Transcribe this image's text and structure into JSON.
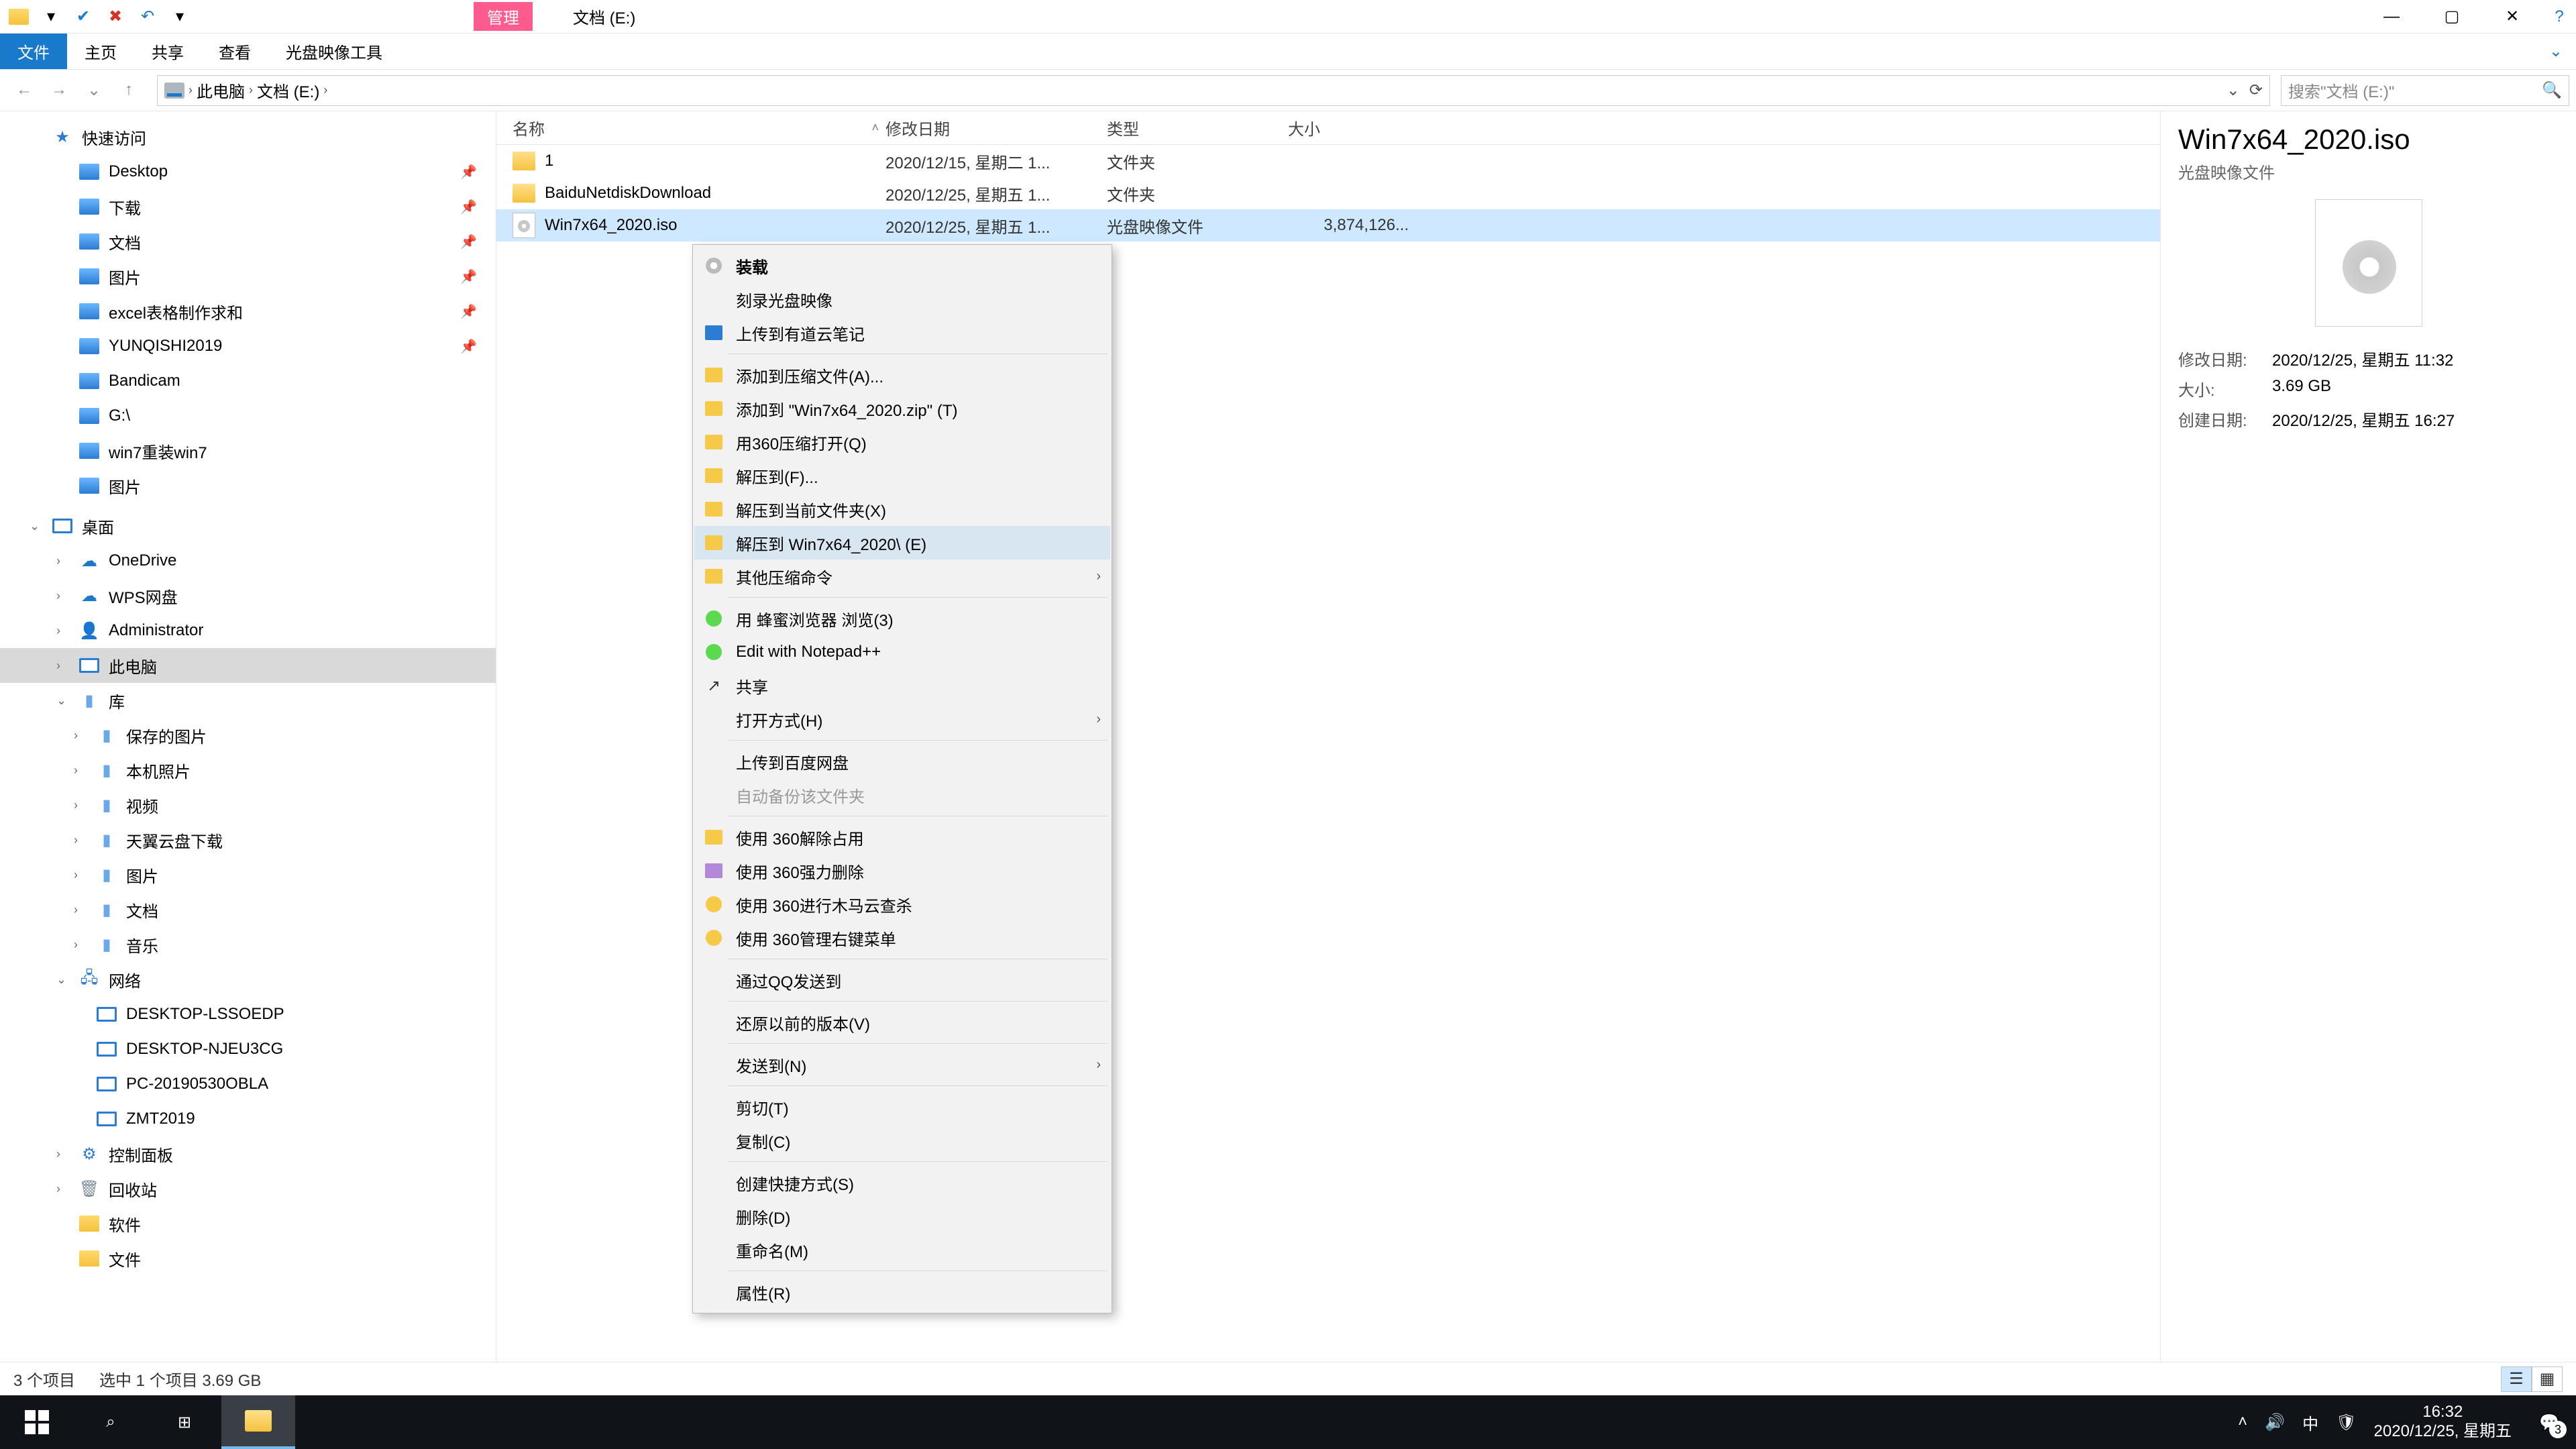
{
  "window": {
    "context_tab": "管理",
    "title": "文档 (E:)",
    "tabs": {
      "file": "文件",
      "home": "主页",
      "share": "共享",
      "view": "查看",
      "image_tool": "光盘映像工具"
    }
  },
  "address": {
    "crumbs": [
      "此电脑",
      "文档 (E:)"
    ],
    "search_placeholder": "搜索\"文档 (E:)\""
  },
  "tree": {
    "quick": "快速访问",
    "quick_items": [
      "Desktop",
      "下载",
      "文档",
      "图片",
      "excel表格制作求和",
      "YUNQISHI2019",
      "Bandicam",
      "G:\\",
      "win7重装win7",
      "图片"
    ],
    "desktop_root": "桌面",
    "desktop_items": [
      "OneDrive",
      "WPS网盘",
      "Administrator",
      "此电脑",
      "库"
    ],
    "lib_items": [
      "保存的图片",
      "本机照片",
      "视频",
      "天翼云盘下载",
      "图片",
      "文档",
      "音乐"
    ],
    "network": "网络",
    "net_items": [
      "DESKTOP-LSSOEDP",
      "DESKTOP-NJEU3CG",
      "PC-20190530OBLA",
      "ZMT2019"
    ],
    "others": [
      "控制面板",
      "回收站",
      "软件",
      "文件"
    ]
  },
  "columns": {
    "name": "名称",
    "date": "修改日期",
    "type": "类型",
    "size": "大小"
  },
  "rows": [
    {
      "name": "1",
      "date": "2020/12/15, 星期二 1...",
      "type": "文件夹",
      "size": ""
    },
    {
      "name": "BaiduNetdiskDownload",
      "date": "2020/12/25, 星期五 1...",
      "type": "文件夹",
      "size": ""
    },
    {
      "name": "Win7x64_2020.iso",
      "date": "2020/12/25, 星期五 1...",
      "type": "光盘映像文件",
      "size": "3,874,126..."
    }
  ],
  "ctx": {
    "items": [
      {
        "label": "装载",
        "icon": "disc",
        "bold": true
      },
      {
        "label": "刻录光盘映像",
        "icon": ""
      },
      {
        "label": "上传到有道云笔记",
        "icon": "sq-b"
      },
      {
        "sep": true
      },
      {
        "label": "添加到压缩文件(A)...",
        "icon": "sq-y"
      },
      {
        "label": "添加到 \"Win7x64_2020.zip\" (T)",
        "icon": "sq-y"
      },
      {
        "label": "用360压缩打开(Q)",
        "icon": "sq-y"
      },
      {
        "label": "解压到(F)...",
        "icon": "sq-y"
      },
      {
        "label": "解压到当前文件夹(X)",
        "icon": "sq-y"
      },
      {
        "label": "解压到 Win7x64_2020\\ (E)",
        "icon": "sq-y",
        "hover": true
      },
      {
        "label": "其他压缩命令",
        "icon": "sq-y",
        "sub": true
      },
      {
        "sep": true
      },
      {
        "label": "用 蜂蜜浏览器 浏览(3)",
        "icon": "circ-g"
      },
      {
        "label": "Edit with Notepad++",
        "icon": "circ-g"
      },
      {
        "label": "共享",
        "icon": "share"
      },
      {
        "label": "打开方式(H)",
        "icon": "",
        "sub": true
      },
      {
        "sep": true
      },
      {
        "label": "上传到百度网盘",
        "icon": ""
      },
      {
        "label": "自动备份该文件夹",
        "icon": "",
        "disabled": true
      },
      {
        "sep": true
      },
      {
        "label": "使用 360解除占用",
        "icon": "sq-y"
      },
      {
        "label": "使用 360强力删除",
        "icon": "sq-p"
      },
      {
        "label": "使用 360进行木马云查杀",
        "icon": "circ-y"
      },
      {
        "label": "使用 360管理右键菜单",
        "icon": "circ-y"
      },
      {
        "sep": true
      },
      {
        "label": "通过QQ发送到",
        "icon": ""
      },
      {
        "sep": true
      },
      {
        "label": "还原以前的版本(V)",
        "icon": ""
      },
      {
        "sep": true
      },
      {
        "label": "发送到(N)",
        "icon": "",
        "sub": true
      },
      {
        "sep": true
      },
      {
        "label": "剪切(T)",
        "icon": ""
      },
      {
        "label": "复制(C)",
        "icon": ""
      },
      {
        "sep": true
      },
      {
        "label": "创建快捷方式(S)",
        "icon": ""
      },
      {
        "label": "删除(D)",
        "icon": ""
      },
      {
        "label": "重命名(M)",
        "icon": ""
      },
      {
        "sep": true
      },
      {
        "label": "属性(R)",
        "icon": ""
      }
    ]
  },
  "details": {
    "title": "Win7x64_2020.iso",
    "subtitle": "光盘映像文件",
    "meta": {
      "mod_label": "修改日期:",
      "mod": "2020/12/25, 星期五 11:32",
      "size_label": "大小:",
      "size": "3.69 GB",
      "created_label": "创建日期:",
      "created": "2020/12/25, 星期五 16:27"
    }
  },
  "status": {
    "count": "3 个项目",
    "selected": "选中 1 个项目  3.69 GB"
  },
  "taskbar": {
    "ime": "中",
    "time": "16:32",
    "date": "2020/12/25, 星期五",
    "notif_count": "3"
  }
}
